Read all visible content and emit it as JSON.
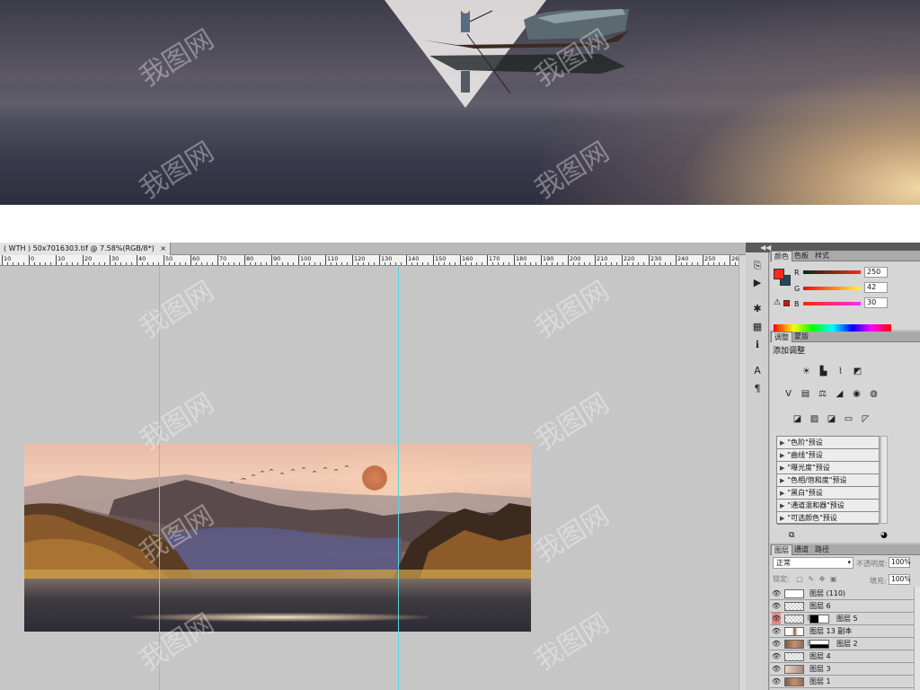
{
  "document": {
    "tab_title": "( WTH ) 50x7016303.tif @ 7.58%(RGB/8*)",
    "close_glyph": "×",
    "zoom": "7.58%"
  },
  "ruler": {
    "labels": [
      "10",
      "0",
      "10",
      "20",
      "30",
      "40",
      "50",
      "60",
      "70",
      "80",
      "90",
      "100",
      "110",
      "120",
      "130",
      "140",
      "150",
      "160",
      "170",
      "180",
      "190",
      "200",
      "210",
      "220",
      "230",
      "240",
      "250",
      "260"
    ]
  },
  "color_panel": {
    "tabs": [
      "颜色",
      "色板",
      "样式"
    ],
    "fg_color": "#fa2a1e",
    "bg_color": "#1e4a5a",
    "channels": [
      {
        "label": "R",
        "value": "250"
      },
      {
        "label": "G",
        "value": "42"
      },
      {
        "label": "B",
        "value": "30"
      }
    ]
  },
  "adjustments_panel": {
    "tabs": [
      "调整",
      "蒙版"
    ],
    "title": "添加调整",
    "presets": [
      "\"色阶\"预设",
      "\"曲线\"预设",
      "\"曝光度\"预设",
      "\"色相/饱和度\"预设",
      "\"黑白\"预设",
      "\"通道混和器\"预设",
      "\"可选颜色\"预设"
    ]
  },
  "layers_panel": {
    "tabs": [
      "图层",
      "通道",
      "路径"
    ],
    "blend_mode": "正常",
    "opacity_label": "不透明度:",
    "opacity_value": "100%",
    "lock_label": "锁定:",
    "fill_label": "填充:",
    "fill_value": "100%",
    "layers": [
      {
        "name": "图层 (110)"
      },
      {
        "name": "图层 6"
      },
      {
        "name": "图层 5"
      },
      {
        "name": "图层 13 副本"
      },
      {
        "name": "图层 2"
      },
      {
        "name": "图层 4"
      },
      {
        "name": "图层 3"
      },
      {
        "name": "图层 1"
      }
    ]
  },
  "watermark_text": "我图网"
}
